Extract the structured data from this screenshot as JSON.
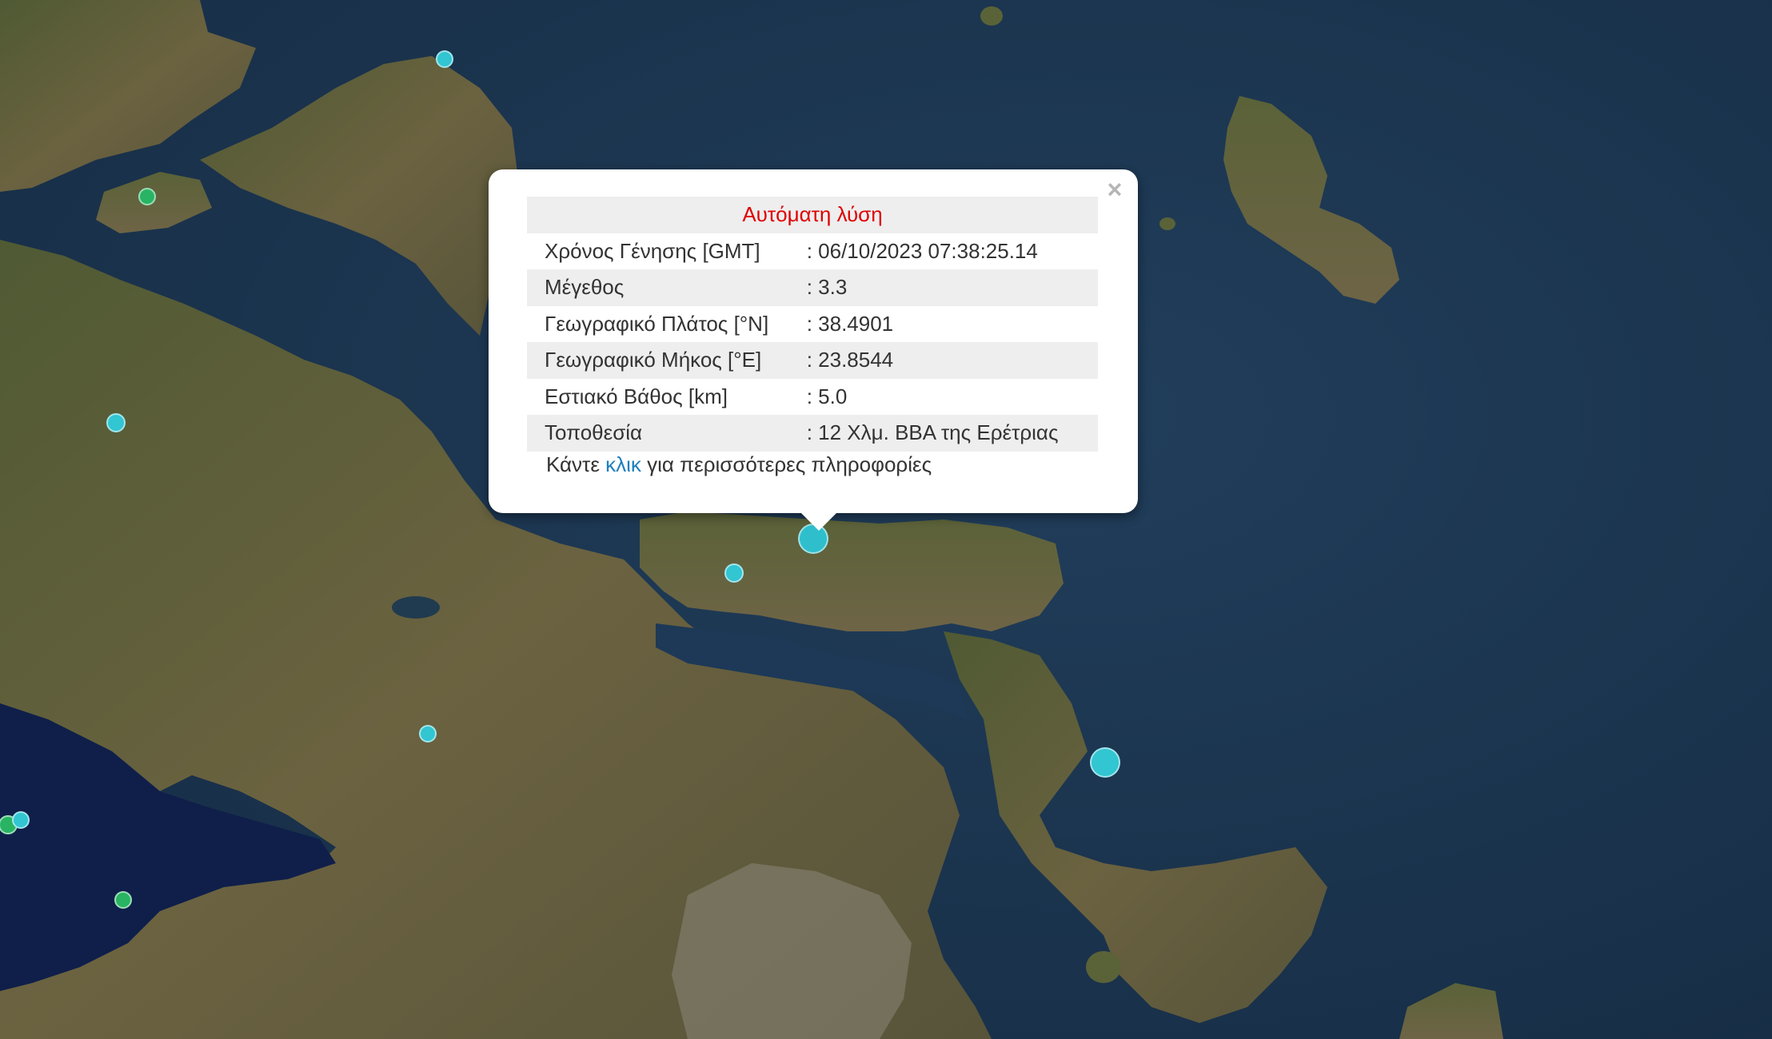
{
  "map": {
    "basemap": "satellite",
    "colors": {
      "sea": "#1b3550",
      "land": "#5d5a3a",
      "marker_recent": "#32c5d2",
      "marker_older": "#28b463"
    },
    "markers": [
      {
        "id": "m1",
        "kind": "cyan"
      },
      {
        "id": "m2",
        "kind": "green"
      },
      {
        "id": "m3",
        "kind": "cyan"
      },
      {
        "id": "m4",
        "kind": "cyan",
        "selected": true
      },
      {
        "id": "m5",
        "kind": "cyan"
      },
      {
        "id": "m6",
        "kind": "cyan"
      },
      {
        "id": "m7",
        "kind": "cyan"
      },
      {
        "id": "m8",
        "kind": "green"
      },
      {
        "id": "m9",
        "kind": "green"
      },
      {
        "id": "m10",
        "kind": "green"
      }
    ]
  },
  "popup": {
    "close_icon": "×",
    "header": "Αυτόματη λύση",
    "rows": [
      {
        "label": "Χρόνος Γένησης [GMT]",
        "value": ": 06/10/2023 07:38:25.14"
      },
      {
        "label": "Μέγεθος",
        "value": ": 3.3"
      },
      {
        "label": "Γεωγραφικό Πλάτος [°N]",
        "value": ": 38.4901"
      },
      {
        "label": "Γεωγραφικό Μήκος [°E]",
        "value": ": 23.8544"
      },
      {
        "label": "Εστιακό Βάθος [km]",
        "value": ": 5.0"
      },
      {
        "label": "Τοποθεσία",
        "value": ": 12 Χλμ. ΒΒΑ της Ερέτριας"
      }
    ],
    "more_prefix": "Κάντε ",
    "more_link": "κλικ",
    "more_suffix": " για περισσότερες πληροφορίες"
  }
}
